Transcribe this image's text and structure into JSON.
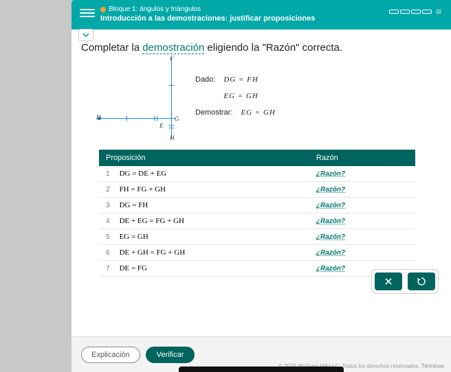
{
  "header": {
    "breadcrumb": "Bloque 1: ángulos y triángulos",
    "title": "Introducción a las demostraciones: justificar proposiciones",
    "progress_label": "0/"
  },
  "prompt": {
    "pre": "Completar la ",
    "link": "demostración",
    "post": " eligiendo la \"Razón\" correcta."
  },
  "diagram": {
    "labels": {
      "D": "D",
      "E": "E",
      "F": "F",
      "G": "G",
      "H": "H"
    }
  },
  "givens": {
    "dado_label": "Dado:",
    "given1": "DG = FH",
    "given2": "EG = GH",
    "demostrar_label": "Demostrar:",
    "prove": "EG = GH"
  },
  "table": {
    "col1": "Proposición",
    "col2": "Razón",
    "reason_placeholder": "¿Razón?",
    "rows": [
      {
        "n": "1",
        "p": "DG = DE + EG"
      },
      {
        "n": "2",
        "p": "FH = FG + GH"
      },
      {
        "n": "3",
        "p": "DG = FH"
      },
      {
        "n": "4",
        "p": "DE + EG = FG + GH"
      },
      {
        "n": "5",
        "p": "EG = GH"
      },
      {
        "n": "6",
        "p": "DE + GH = FG + GH"
      },
      {
        "n": "7",
        "p": "DE = FG"
      }
    ]
  },
  "footer": {
    "explain": "Explicación",
    "verify": "Verificar",
    "copyright": "© 2025 McGraw Hill LLC. Todos los derechos reservados.",
    "terms": "Términos"
  }
}
